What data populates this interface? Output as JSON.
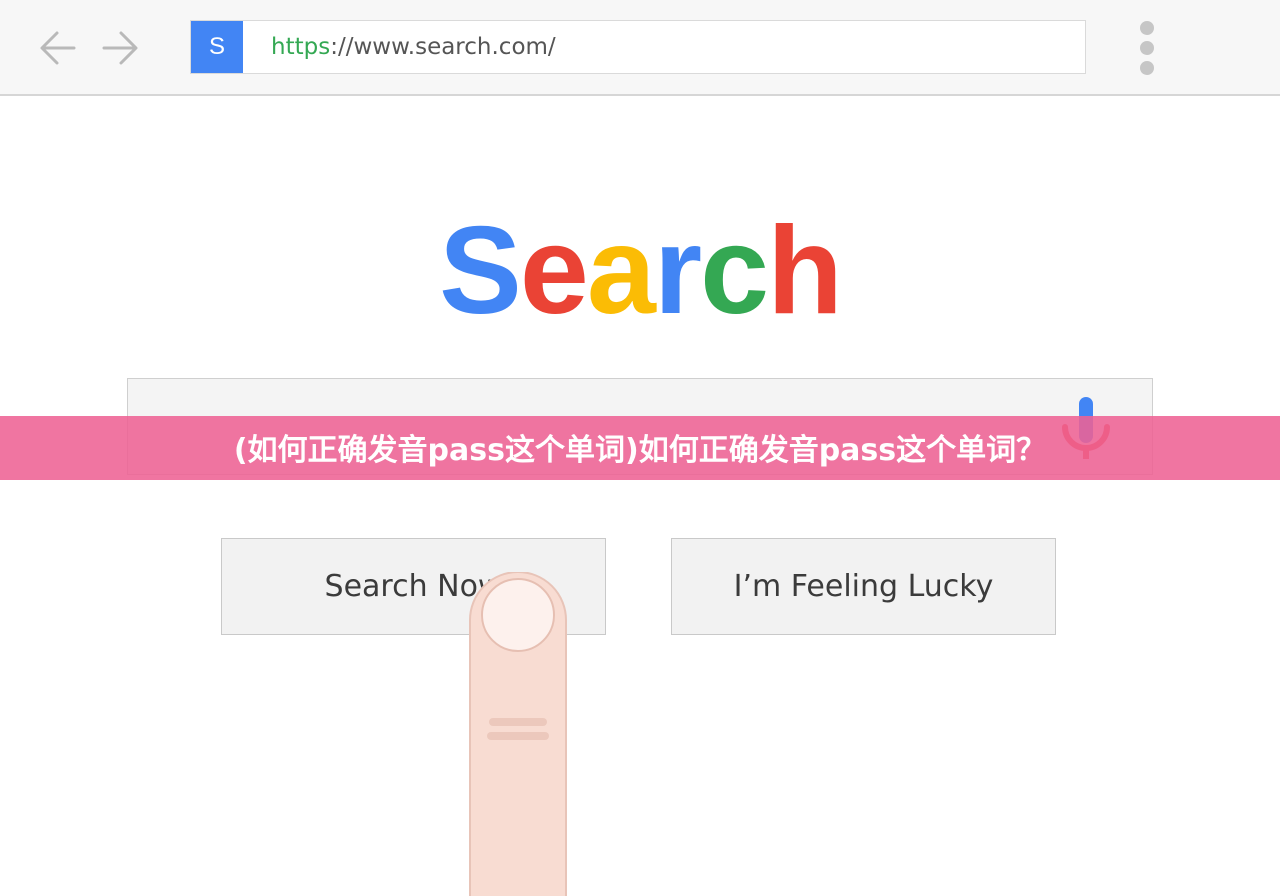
{
  "browser": {
    "favicon_letter": "S",
    "url_scheme": "https",
    "url_rest": "://www.search.com/",
    "accent": "#4285f4",
    "back_icon": "arrow-left-icon",
    "forward_icon": "arrow-right-icon",
    "menu_icon": "more-vertical-icon"
  },
  "logo": {
    "letters": [
      {
        "char": "S",
        "color": "#4285f4"
      },
      {
        "char": "e",
        "color": "#ea4335"
      },
      {
        "char": "a",
        "color": "#fbbc05"
      },
      {
        "char": "r",
        "color": "#4285f4"
      },
      {
        "char": "c",
        "color": "#34a853"
      },
      {
        "char": "h",
        "color": "#ea4335"
      }
    ]
  },
  "search": {
    "value": "",
    "mic_icon": "microphone-icon"
  },
  "buttons": {
    "search_now": "Search Now",
    "feeling_lucky": "I’m Feeling Lucky"
  },
  "banner": {
    "text": "(如何正确发音pass这个单词)如何正确发音pass这个单词？",
    "color": "#ee6294"
  },
  "illustration": {
    "finger_icon": "pointing-finger-icon"
  }
}
